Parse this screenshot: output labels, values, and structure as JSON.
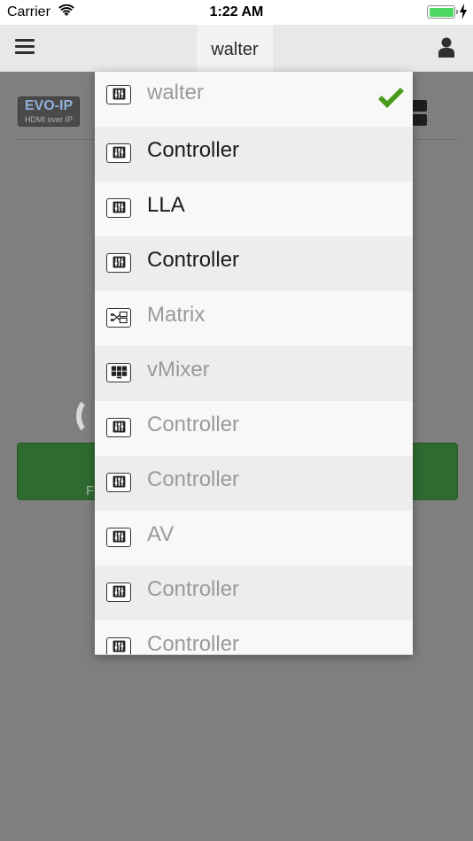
{
  "status_bar": {
    "carrier": "Carrier",
    "time": "1:22 AM",
    "battery_level_fraction": 1.0
  },
  "nav": {
    "title": "walter",
    "left_icon": "hamburger-menu-icon",
    "right_icon": "user-icon"
  },
  "background": {
    "logo_text": "EVO-IP",
    "logo_subtext": "HDMI over IP",
    "button_fragment": "F",
    "button_color": "#2f6a31"
  },
  "dropdown": {
    "items": [
      {
        "label": "walter",
        "icon": "controller-icon",
        "enabled": false,
        "selected": true
      },
      {
        "label": "Controller",
        "icon": "controller-icon",
        "enabled": true,
        "selected": false
      },
      {
        "label": "LLA",
        "icon": "controller-icon",
        "enabled": true,
        "selected": false
      },
      {
        "label": "Controller",
        "icon": "controller-icon",
        "enabled": true,
        "selected": false
      },
      {
        "label": "Matrix",
        "icon": "matrix-icon",
        "enabled": false,
        "selected": false
      },
      {
        "label": "vMixer",
        "icon": "vmixer-icon",
        "enabled": false,
        "selected": false
      },
      {
        "label": "Controller",
        "icon": "controller-icon",
        "enabled": false,
        "selected": false
      },
      {
        "label": "Controller",
        "icon": "controller-icon",
        "enabled": false,
        "selected": false
      },
      {
        "label": "AV",
        "icon": "controller-icon",
        "enabled": false,
        "selected": false
      },
      {
        "label": "Controller",
        "icon": "controller-icon",
        "enabled": false,
        "selected": false
      },
      {
        "label": "Controller",
        "icon": "controller-icon",
        "enabled": false,
        "selected": false
      }
    ],
    "check_color": "#4a9a1c"
  }
}
